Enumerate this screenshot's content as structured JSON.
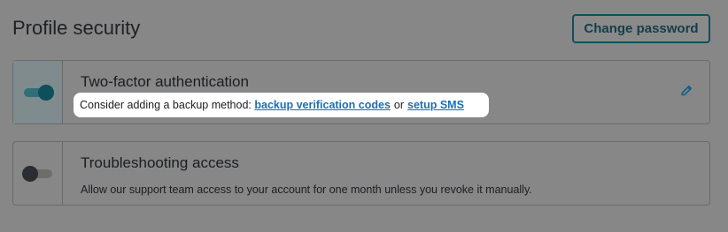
{
  "header": {
    "title": "Profile security",
    "change_password_label": "Change password"
  },
  "two_factor": {
    "title": "Two-factor authentication",
    "enabled": true,
    "backup_prefix": "Consider adding a backup method:",
    "backup_link_codes": "backup verification codes",
    "backup_or": "or",
    "backup_link_sms": "setup SMS",
    "edit_icon": "pencil-icon"
  },
  "troubleshooting": {
    "title": "Troubleshooting access",
    "enabled": false,
    "description": "Allow our support team access to your account for one month unless you revoke it manually."
  },
  "colors": {
    "overlay": "#878787",
    "link": "#1a6fb5",
    "accent": "#144e5a"
  }
}
